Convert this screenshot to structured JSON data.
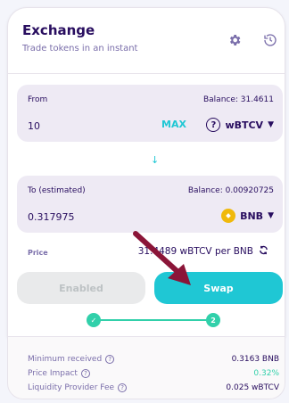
{
  "header": {
    "title": "Exchange",
    "subtitle": "Trade tokens in an instant",
    "settings_icon": "gear-icon",
    "history_icon": "history-icon"
  },
  "from": {
    "label": "From",
    "balance": "Balance: 31.4611",
    "amount": "10",
    "max_label": "MAX",
    "token": "wBTCV",
    "token_icon": "question-circle-icon"
  },
  "swap_direction_icon": "arrow-down-icon",
  "to": {
    "label": "To (estimated)",
    "balance": "Balance: 0.00920725",
    "amount": "0.317975",
    "token": "BNB",
    "token_icon": "bnb-coin-icon"
  },
  "price": {
    "label": "Price",
    "value": "31.4489 wBTCV per BNB"
  },
  "buttons": {
    "enabled_label": "Enabled",
    "swap_label": "Swap"
  },
  "stepper": {
    "step1": "✓",
    "step2": "2"
  },
  "details": {
    "min_received_label": "Minimum received",
    "min_received_value": "0.3163 BNB",
    "price_impact_label": "Price Impact",
    "price_impact_value": "0.32%",
    "lp_fee_label": "Liquidity Provider Fee",
    "lp_fee_value": "0.025 wBTCV"
  },
  "colors": {
    "primary": "#1fc7d4",
    "text": "#280d5f",
    "success": "#31d0aa",
    "annotation_arrow": "#8b1538"
  }
}
